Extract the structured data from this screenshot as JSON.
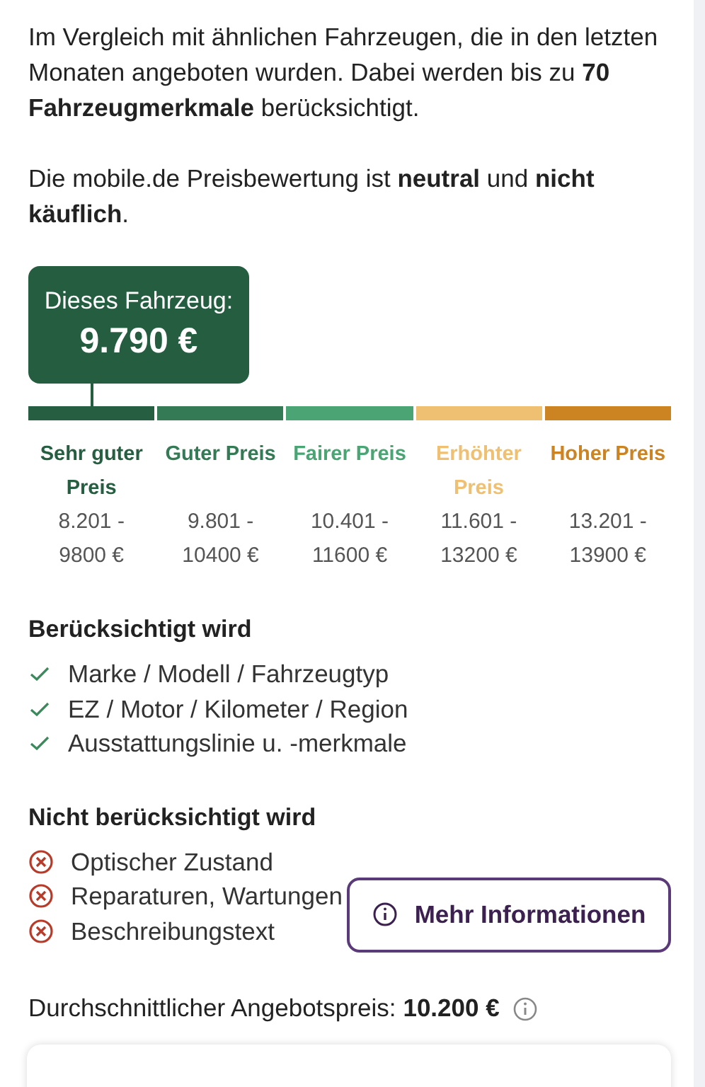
{
  "intro": "Im Vergleich mit ähnlichen Fahrzeugen, die in den letzten Monaten angeboten wurden. Dabei werden bis zu **70 Fahrzeugmerkmale** berücksichtigt.",
  "verdict": "Die mobile.de Preisbewertung ist **neutral** und **nicht käuflich**.",
  "vehicle_price": {
    "label": "Dieses Fahrzeug:",
    "value": "9.790 €"
  },
  "price_bands": [
    {
      "label": "Sehr guter Preis",
      "range": "8.201 - 9800 €",
      "color": "#255e40",
      "selected": true
    },
    {
      "label": "Guter Preis",
      "range": "9.801 - 10400 €",
      "color": "#337a55",
      "selected": false
    },
    {
      "label": "Fairer Preis",
      "range": "10.401 - 11600 €",
      "color": "#4aa474",
      "selected": false
    },
    {
      "label": "Erhöhter Preis",
      "range": "11.601 - 13200 €",
      "color": "#efc072",
      "selected": false
    },
    {
      "label": "Hoher Preis",
      "range": "13.201 - 13900 €",
      "color": "#cc8423",
      "selected": false
    }
  ],
  "considered": {
    "title": "Berücksichtigt wird",
    "items": [
      "Marke / Modell / Fahrzeugtyp",
      "EZ / Motor / Kilometer / Region",
      "Ausstattungslinie u. -merkmale"
    ]
  },
  "not_considered": {
    "title": "Nicht berücksichtigt wird",
    "items": [
      "Optischer Zustand",
      "Reparaturen, Wartungen",
      "Beschreibungstext"
    ]
  },
  "more_info_button": "Mehr Informationen",
  "average": {
    "label": "Durchschnittlicher Angebotspreis:",
    "value": "10.200 €"
  }
}
